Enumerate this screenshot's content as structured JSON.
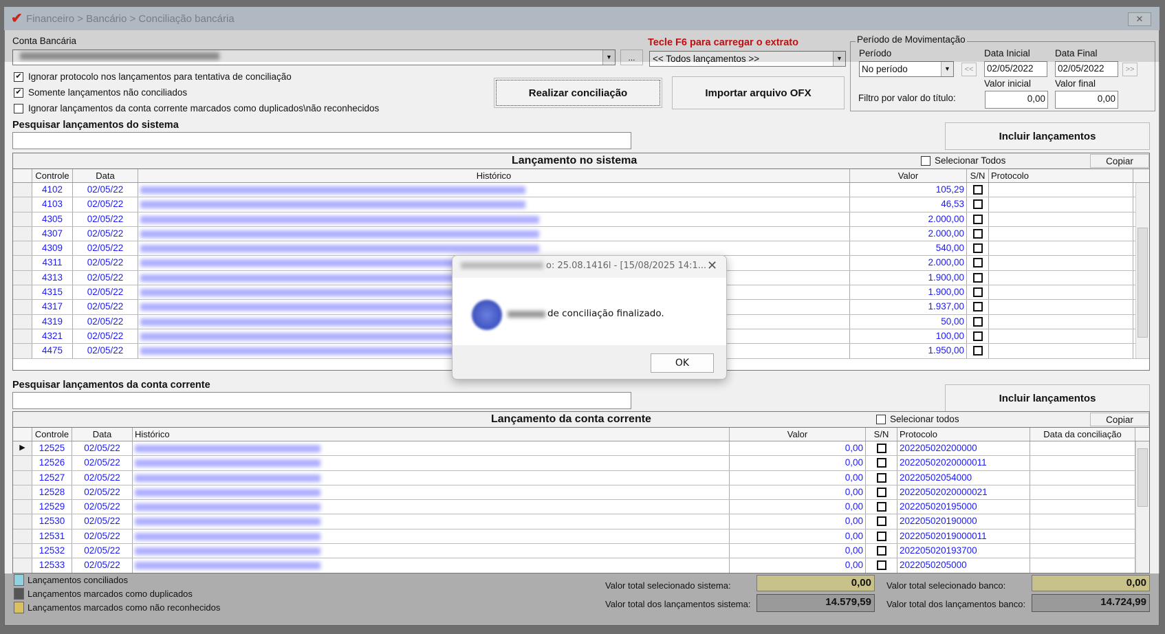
{
  "window": {
    "breadcrumb": "Financeiro > Bancário > Conciliação bancária",
    "close": "✕"
  },
  "conta": {
    "label": "Conta Bancária",
    "more": "..."
  },
  "extrato": {
    "hint": "Tecle F6 para carregar o extrato",
    "selected": "<< Todos lançamentos >>"
  },
  "options": [
    {
      "label": "Ignorar protocolo nos lançamentos para tentativa de conciliação",
      "checked": true
    },
    {
      "label": "Somente lançamentos não conciliados",
      "checked": true
    },
    {
      "label": "Ignorar lançamentos da conta corrente marcados como duplicados\\não reconhecidos",
      "checked": false
    }
  ],
  "buttons": {
    "realizar": "Realizar conciliação",
    "importar": "Importar arquivo OFX",
    "incluir": "Incluir lançamentos",
    "copiar": "Copiar",
    "ok": "OK"
  },
  "periodo": {
    "group": "Período de Movimentação",
    "label": "Período",
    "selected": "No período",
    "data_inicial_label": "Data Inicial",
    "data_inicial": "02/05/2022",
    "data_final_label": "Data Final",
    "data_final": "02/05/2022",
    "prev": "<<",
    "next": ">>",
    "filtro_label": "Filtro por valor do título:",
    "valor_inicial_label": "Valor inicial",
    "valor_inicial": "0,00",
    "valor_final_label": "Valor final",
    "valor_final": "0,00"
  },
  "sistema": {
    "search_label": "Pesquisar lançamentos do sistema",
    "title": "Lançamento no sistema",
    "select_all": "Selecionar Todos",
    "columns": [
      "Controle",
      "Data",
      "Histórico",
      "Valor",
      "S/N",
      "Protocolo"
    ],
    "rows": [
      [
        "4102",
        "02/05/22",
        "105,29"
      ],
      [
        "4103",
        "02/05/22",
        "46,53"
      ],
      [
        "4305",
        "02/05/22",
        "2.000,00"
      ],
      [
        "4307",
        "02/05/22",
        "2.000,00"
      ],
      [
        "4309",
        "02/05/22",
        "540,00"
      ],
      [
        "4311",
        "02/05/22",
        "2.000,00"
      ],
      [
        "4313",
        "02/05/22",
        "1.900,00"
      ],
      [
        "4315",
        "02/05/22",
        "1.900,00"
      ],
      [
        "4317",
        "02/05/22",
        "1.937,00"
      ],
      [
        "4319",
        "02/05/22",
        "50,00"
      ],
      [
        "4321",
        "02/05/22",
        "100,00"
      ],
      [
        "4475",
        "02/05/22",
        "1.950,00"
      ]
    ]
  },
  "conta_corrente": {
    "search_label": "Pesquisar lançamentos da conta corrente",
    "title": "Lançamento da conta corrente",
    "select_all": "Selecionar todos",
    "columns": [
      "Controle",
      "Data",
      "Histórico",
      "Valor",
      "S/N",
      "Protocolo",
      "Data da conciliação"
    ],
    "rows": [
      [
        "12525",
        "02/05/22",
        "0,00",
        "202205020200000"
      ],
      [
        "12526",
        "02/05/22",
        "0,00",
        "20220502020000011"
      ],
      [
        "12527",
        "02/05/22",
        "0,00",
        "20220502054000"
      ],
      [
        "12528",
        "02/05/22",
        "0,00",
        "20220502020000021"
      ],
      [
        "12529",
        "02/05/22",
        "0,00",
        "202205020195000"
      ],
      [
        "12530",
        "02/05/22",
        "0,00",
        "202205020190000"
      ],
      [
        "12531",
        "02/05/22",
        "0,00",
        "20220502019000011"
      ],
      [
        "12532",
        "02/05/22",
        "0,00",
        "202205020193700"
      ],
      [
        "12533",
        "02/05/22",
        "0,00",
        "2022050205000"
      ]
    ]
  },
  "legend": [
    {
      "label": "Lançamentos conciliados",
      "color": "#8fd3e0"
    },
    {
      "label": "Lançamentos marcados como duplicados",
      "color": "#555555"
    },
    {
      "label": "Lançamentos marcados como não reconhecidos",
      "color": "#d9c060"
    }
  ],
  "totals": {
    "sel_sistema_label": "Valor total selecionado sistema:",
    "sel_sistema": "0,00",
    "tot_sistema_label": "Valor total dos lançamentos sistema:",
    "tot_sistema": "14.579,59",
    "sel_banco_label": "Valor total selecionado banco:",
    "sel_banco": "0,00",
    "tot_banco_label": "Valor total dos lançamentos banco:",
    "tot_banco": "14.724,99"
  },
  "dialog": {
    "title": "o: 25.08.1416l - [15/08/2025 14:1...",
    "message": "de conciliação finalizado."
  }
}
